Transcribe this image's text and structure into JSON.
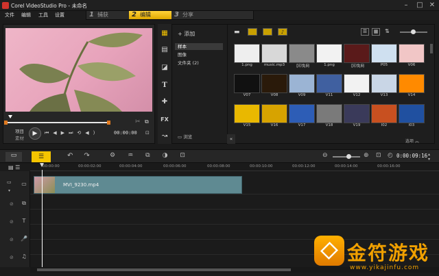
{
  "window": {
    "title": "Corel VideoStudio Pro - 未命名"
  },
  "menu": [
    "文件",
    "编辑",
    "工具",
    "设置"
  ],
  "steps": [
    {
      "num": "1",
      "label": "捕获"
    },
    {
      "num": "2",
      "label": "编辑"
    },
    {
      "num": "3",
      "label": "分享"
    }
  ],
  "preview": {
    "mode_project": "项目",
    "mode_clip": "素材",
    "timecode": "00:00:00"
  },
  "library": {
    "add_label": "添加",
    "folders": [
      "样本",
      "图像",
      "文件夹 (2)"
    ],
    "browse_label": "浏览",
    "options_label": "选项",
    "thumbnails": [
      {
        "label": "1.png",
        "color": "#eeeeee"
      },
      {
        "label": "music.mp3",
        "color": "#d8d8d8"
      },
      {
        "label": "【印免网",
        "color": "#8a8a8a"
      },
      {
        "label": "1.png",
        "color": "#f2f2f2"
      },
      {
        "label": "【印免网",
        "color": "#5a1a1a"
      },
      {
        "label": "P05",
        "color": "#cfe0f0"
      },
      {
        "label": "V06",
        "color": "#f1c6c6"
      },
      {
        "label": "V07",
        "color": "#111111"
      },
      {
        "label": "V08",
        "color": "#2a1a0a"
      },
      {
        "label": "V09",
        "color": "#9bb4d4"
      },
      {
        "label": "V11",
        "color": "#4060a0"
      },
      {
        "label": "V12",
        "color": "#f2f2f2"
      },
      {
        "label": "V13",
        "color": "#c9d6e6"
      },
      {
        "label": "V14",
        "color": "#ff8a00"
      },
      {
        "label": "V15",
        "color": "#e9b800"
      },
      {
        "label": "V16",
        "color": "#d7a300"
      },
      {
        "label": "V17",
        "color": "#2d5db6"
      },
      {
        "label": "V18",
        "color": "#7a7a7a"
      },
      {
        "label": "V19",
        "color": "#3a3a5a"
      },
      {
        "label": "I02",
        "color": "#c85020"
      },
      {
        "label": "I03",
        "color": "#2050a0"
      }
    ]
  },
  "timeline": {
    "timecode": "0:00:09:16",
    "ruler": [
      "00:00:00",
      "00:00:02:00",
      "00:00:04:00",
      "00:00:06:00",
      "00:00:08:00",
      "00:00:10:00",
      "00:00:12:00",
      "00:00:14:00",
      "00:00:16:00"
    ],
    "clip_name": "MVI_9230.mp4"
  },
  "watermark": {
    "brand": "金符游戏",
    "url": "www.yikajinfu.com"
  },
  "colors": {
    "accent": "#f5c400",
    "clip": "#5f8a92",
    "watermark": "#f0a000"
  }
}
